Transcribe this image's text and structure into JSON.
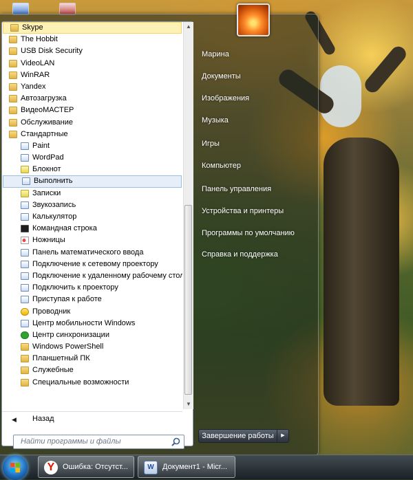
{
  "programs": [
    {
      "label": "Skype",
      "icon": "folder-icon",
      "level": 0,
      "state": "highlighted"
    },
    {
      "label": "The Hobbit",
      "icon": "folder-icon",
      "level": 0
    },
    {
      "label": "USB Disk Security",
      "icon": "folder-icon",
      "level": 0
    },
    {
      "label": "VideoLAN",
      "icon": "folder-icon",
      "level": 0
    },
    {
      "label": "WinRAR",
      "icon": "folder-icon",
      "level": 0
    },
    {
      "label": "Yandex",
      "icon": "folder-icon",
      "level": 0
    },
    {
      "label": "Автозагрузка",
      "icon": "folder-icon",
      "level": 0
    },
    {
      "label": "ВидеоМАСТЕР",
      "icon": "folder-icon",
      "level": 0
    },
    {
      "label": "Обслуживание",
      "icon": "folder-icon",
      "level": 0
    },
    {
      "label": "Стандартные",
      "icon": "folder-open-icon",
      "level": 0
    },
    {
      "label": "Paint",
      "icon": "paint-icon",
      "level": 1
    },
    {
      "label": "WordPad",
      "icon": "wordpad-icon",
      "level": 1
    },
    {
      "label": "Блокнот",
      "icon": "notepad-icon",
      "level": 1
    },
    {
      "label": "Выполнить",
      "icon": "run-icon",
      "level": 1,
      "state": "selected"
    },
    {
      "label": "Записки",
      "icon": "sticky-notes-icon",
      "level": 1
    },
    {
      "label": "Звукозапись",
      "icon": "microphone-icon",
      "level": 1
    },
    {
      "label": "Калькулятор",
      "icon": "calculator-icon",
      "level": 1
    },
    {
      "label": "Командная строка",
      "icon": "command-prompt-icon",
      "level": 1
    },
    {
      "label": "Ножницы",
      "icon": "scissors-icon",
      "level": 1
    },
    {
      "label": "Панель математического ввода",
      "icon": "math-input-icon",
      "level": 1
    },
    {
      "label": "Подключение к сетевому проектору",
      "icon": "network-projector-icon",
      "level": 1
    },
    {
      "label": "Подключение к удаленному рабочему столу",
      "icon": "remote-desktop-icon",
      "level": 1
    },
    {
      "label": "Подключить к проектору",
      "icon": "projector-icon",
      "level": 1
    },
    {
      "label": "Приступая к работе",
      "icon": "getting-started-icon",
      "level": 1
    },
    {
      "label": "Проводник",
      "icon": "explorer-icon",
      "level": 1
    },
    {
      "label": "Центр мобильности Windows",
      "icon": "mobility-center-icon",
      "level": 1
    },
    {
      "label": "Центр синхронизации",
      "icon": "sync-center-icon",
      "level": 1
    },
    {
      "label": "Windows PowerShell",
      "icon": "folder-icon",
      "level": 1
    },
    {
      "label": "Планшетный ПК",
      "icon": "folder-icon",
      "level": 1
    },
    {
      "label": "Служебные",
      "icon": "folder-icon",
      "level": 1
    },
    {
      "label": "Специальные возможности",
      "icon": "folder-icon",
      "level": 1
    }
  ],
  "back": {
    "label": "Назад"
  },
  "search": {
    "placeholder": "Найти программы и файлы"
  },
  "right_links": [
    "Марина",
    "Документы",
    "Изображения",
    "Музыка",
    "Игры",
    "Компьютер",
    "Панель управления",
    "Устройства и принтеры",
    "Программы по умолчанию",
    "Справка и поддержка"
  ],
  "shutdown": {
    "label": "Завершение работы"
  },
  "taskbar": {
    "buttons": [
      {
        "label": "Ошибка: Отсутст...",
        "icon": "yandex-browser-icon",
        "glyph": "Y"
      },
      {
        "label": "Документ1 - Micr...",
        "icon": "word-document-icon",
        "glyph": "W"
      }
    ]
  },
  "colors": {
    "highlight": "#fdf2b4",
    "selection": "#e5eef9",
    "link_text": "#ffffff"
  }
}
